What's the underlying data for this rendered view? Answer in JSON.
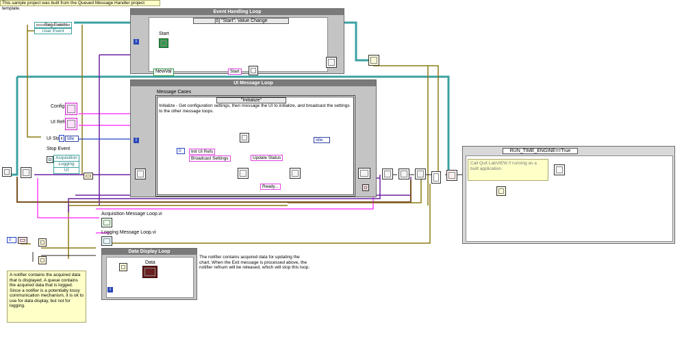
{
  "header_note": "This sample project was built from the Queued Message Handler project template.",
  "event_loop": {
    "title": "Event Handling Loop",
    "selector": "[0] \"Start\": Value Change",
    "start_label": "Start",
    "newval_label": "NewVal",
    "start_message": "Start"
  },
  "reg_events": {
    "label": "Reg Events",
    "type": "User Event"
  },
  "ui_loop": {
    "title": "UI Message Loop",
    "cases_label": "Message Cases",
    "selector": "\"Initialize\"",
    "case_description": "Initialize - Get configuration settings, then message the UI to initialize, and broadcast the settings to the other message loops.",
    "const_zero": "0",
    "msg_init": "Init UI Refs",
    "msg_broadcast": "Broadcast Settings",
    "msg_update": "Update Status",
    "msg_ready": "Ready...",
    "idle_inner": "Idle"
  },
  "left_labels": {
    "config": "Config",
    "ui_refs": "UI Refs",
    "ui_state": "UI State",
    "idle": "Idle",
    "stop_event": "Stop Event"
  },
  "cluster_items": [
    "Acquisition",
    "Logging",
    "UI"
  ],
  "subvis": {
    "acq": "Acquisition Message Loop.vi",
    "log": "Logging Message Loop.vi"
  },
  "data_loop": {
    "title": "Data Display Loop",
    "data_label": "Data"
  },
  "notes": {
    "notifier": "A notifier contains the acquired data that is displayed. A queue contains the acquired data that is logged.  Since a notifier is a potentially lossy communication mechanism, it is ok to use for data display, but not for logging.",
    "chart": "The notifier contains acquired data for updating the chart. When the Exit message is processed above, the notifier refnum will be released, which will stop this loop."
  },
  "run_time": {
    "selector": "RUN_TIME_ENGINE==True",
    "note": "Call Quit LabVIEW if running as a built application."
  },
  "const_zero_left": "0",
  "colors": {
    "pink_wire": "#ff40ff",
    "teal_wire": "#3aa0a0",
    "olive_wire": "#8a7a10",
    "purple_wire": "#6a1fa0",
    "blue_wire": "#2040c0",
    "brown_wire": "#7a5020",
    "loop_gray": "#c4c4c4",
    "note_yellow": "#ffffc8"
  }
}
